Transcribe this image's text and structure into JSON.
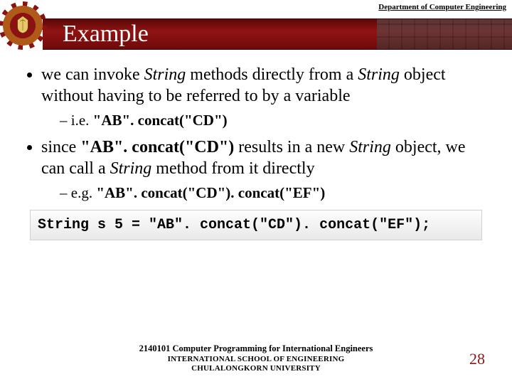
{
  "header": {
    "department": "Department of Computer Engineering",
    "title": "Example"
  },
  "body": {
    "b1_pre": "we can invoke ",
    "b1_str1": "String",
    "b1_mid": " methods directly from a ",
    "b1_str2": "String",
    "b1_post": " object without having to be referred to by a variable",
    "s1_pre": "i.e. ",
    "s1_bold": "\"AB\". concat(\"CD\")",
    "b2_pre": "since ",
    "b2_bold": "\"AB\". concat(\"CD\")",
    "b2_mid1": " results in a new ",
    "b2_str1": "String",
    "b2_mid2": " object, we can call a ",
    "b2_str2": "String",
    "b2_post": " method from it directly",
    "s2_pre": "e.g. ",
    "s2_bold": "\"AB\". concat(\"CD\"). concat(\"EF\")",
    "code": "String s 5 = \"AB\". concat(\"CD\"). concat(\"EF\");"
  },
  "footer": {
    "line1": "2140101 Computer Programming for International Engineers",
    "line2": "INTERNATIONAL SCHOOL OF ENGINEERING",
    "line3": "CHULALONGKORN UNIVERSITY",
    "page": "28"
  }
}
